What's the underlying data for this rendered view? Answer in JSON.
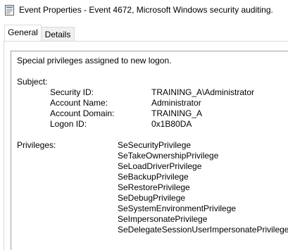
{
  "window": {
    "title": "Event Properties - Event 4672, Microsoft Windows security auditing."
  },
  "tabs": [
    {
      "label": "General"
    },
    {
      "label": "Details"
    }
  ],
  "event": {
    "summary": "Special privileges assigned to new logon.",
    "subject_heading": "Subject:",
    "subject_fields": [
      {
        "label": "Security ID:",
        "value": "TRAINING_A\\Administrator"
      },
      {
        "label": "Account Name:",
        "value": "Administrator"
      },
      {
        "label": "Account Domain:",
        "value": "TRAINING_A"
      },
      {
        "label": "Logon ID:",
        "value": "0x1B80DA"
      }
    ],
    "privileges_heading": "Privileges:",
    "privileges": [
      "SeSecurityPrivilege",
      "SeTakeOwnershipPrivilege",
      "SeLoadDriverPrivilege",
      "SeBackupPrivilege",
      "SeRestorePrivilege",
      "SeDebugPrivilege",
      "SeSystemEnvironmentPrivilege",
      "SeImpersonatePrivilege",
      "SeDelegateSessionUserImpersonatePrivilege"
    ]
  },
  "icons": {
    "title": "event-properties-icon"
  }
}
